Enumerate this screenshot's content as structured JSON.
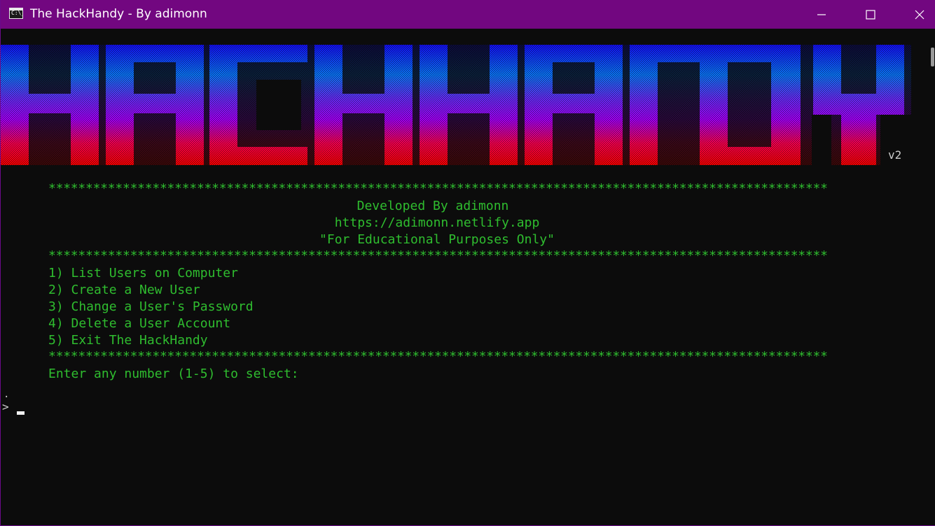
{
  "window": {
    "title": "The HackHandy - By adimonn",
    "app_icon_text": "C:\\_",
    "buttons": {
      "minimize": "minimize-icon",
      "maximize": "maximize-icon",
      "close": "close-icon"
    }
  },
  "banner": {
    "text": "HACKHANDY",
    "version": "v2",
    "gradient": [
      "#1410ff",
      "#0a78ff",
      "#6a2cff",
      "#a600ff",
      "#ff0000"
    ]
  },
  "separator": "*********************************************************************************************************",
  "header": {
    "developed_by": "Developed By adimonn",
    "url": "https://adimonn.netlify.app",
    "disclaimer": "\"For Educational Purposes Only\""
  },
  "menu": [
    "1) List Users on Computer",
    "2) Create a New User",
    "3) Change a User's Password",
    "4) Delete a User Account",
    "5) Exit The HackHandy"
  ],
  "prompt": {
    "question": "Enter any number (1-5) to select:",
    "dot": ".",
    "arrow": ">"
  },
  "colors": {
    "titlebar": "#720780",
    "terminal_bg": "#0c0c0c",
    "terminal_text": "#2fbd2f"
  }
}
